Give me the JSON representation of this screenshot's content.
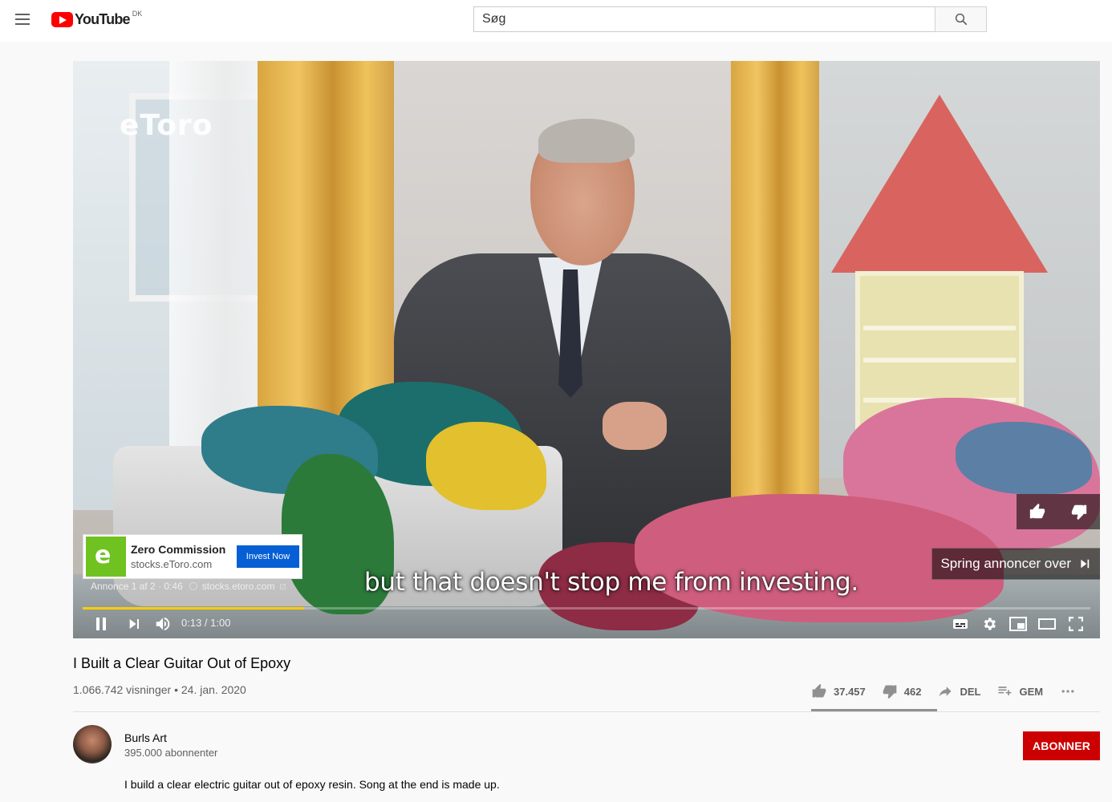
{
  "masthead": {
    "logo_text": "YouTube",
    "country_code": "DK",
    "search_placeholder": "Søg"
  },
  "player": {
    "ad_brand_watermark": "eToro",
    "ad_card": {
      "title": "Zero Commission",
      "url": "stocks.eToro.com",
      "cta": "Invest Now"
    },
    "ad_info": {
      "counter": "Annonce 1 af 2 · 0:46",
      "link": "stocks.etoro.com"
    },
    "subtitle": "but that doesn't stop me from investing.",
    "skip_ads": "Spring annoncer over",
    "time": "0:13 / 1:00",
    "progress_fraction": 0.22,
    "progress_color": "#ffcc00"
  },
  "video": {
    "title": "I Built a Clear Guitar Out of Epoxy",
    "meta": "1.066.742 visninger • 24. jan. 2020",
    "likes": "37.457",
    "dislikes": "462",
    "share_label": "DEL",
    "save_label": "GEM"
  },
  "channel": {
    "name": "Burls Art",
    "subscribers": "395.000 abonnenter",
    "subscribe_label": "ABONNER",
    "subscribe_color": "#cc0000"
  },
  "description": "I build a clear electric guitar out of epoxy resin. Song at the end is made up."
}
